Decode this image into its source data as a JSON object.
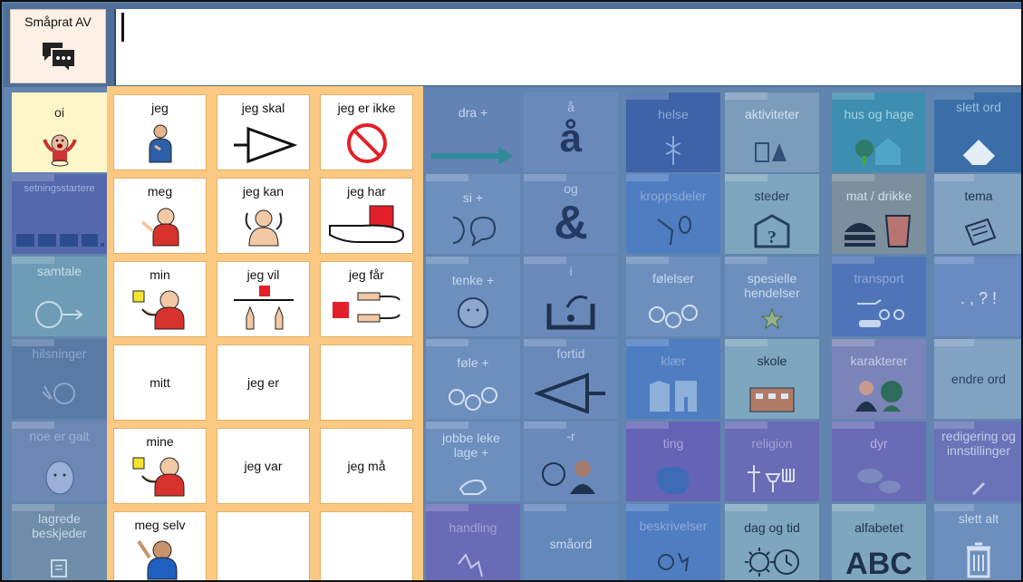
{
  "top": {
    "toggle_label": "Småprat AV"
  },
  "left_column": [
    {
      "label": "oi"
    },
    {
      "label": "setningsstartere"
    },
    {
      "label": "samtale"
    },
    {
      "label": "hilsninger"
    },
    {
      "label": "noe er galt"
    },
    {
      "label": "lagrede beskjeder"
    }
  ],
  "popup": [
    [
      "jeg",
      "jeg skal",
      "jeg er ikke"
    ],
    [
      "meg",
      "jeg kan",
      "jeg har"
    ],
    [
      "min",
      "jeg vil",
      "jeg får"
    ],
    [
      "mitt",
      "jeg er",
      ""
    ],
    [
      "mine",
      "jeg var",
      "jeg må"
    ],
    [
      "meg selv",
      "",
      ""
    ]
  ],
  "grid": [
    [
      "dra +",
      "å",
      "helse",
      "aktiviteter",
      "hus og hage",
      "slett ord"
    ],
    [
      "si +",
      "og",
      "kroppsdeler",
      "steder",
      "mat / drikke",
      "tema"
    ],
    [
      "tenke +",
      "i",
      "følelser",
      "spesielle hendelser",
      "transport",
      ". , ? !"
    ],
    [
      "føle +",
      "fortid",
      "klær",
      "skole",
      "karakterer",
      "endre ord"
    ],
    [
      "jobbe leke lage +",
      "-r",
      "ting",
      "religion",
      "dyr",
      "redigering og innstillinger"
    ],
    [
      "handling",
      "småord",
      "beskrivelser",
      "dag og tid",
      "alfabetet",
      "slett alt"
    ]
  ],
  "symbols": {
    "og_glyph": "&",
    "aa_glyph": "å",
    "abc_glyph": "ABC"
  },
  "colors": {
    "popup_background": "#fcc982",
    "dim_overlay": "#6285b0"
  }
}
